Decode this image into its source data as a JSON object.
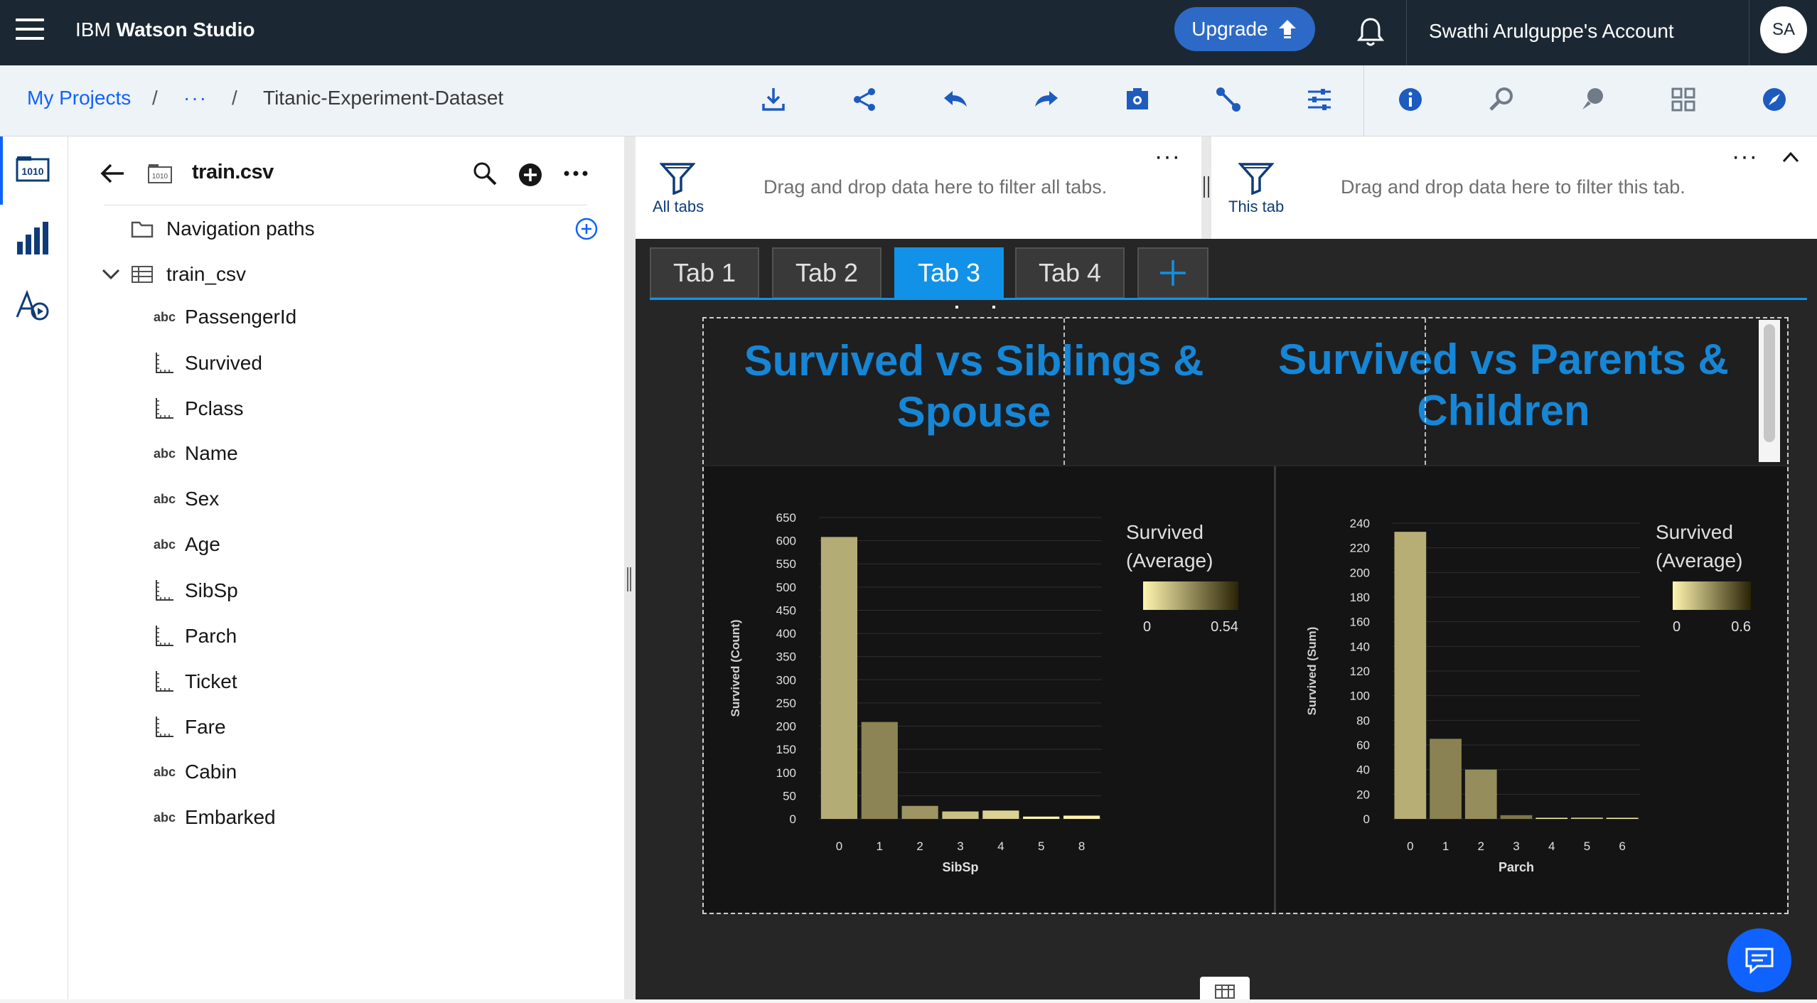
{
  "topbar": {
    "brand_prefix": "IBM",
    "brand_name": "Watson Studio",
    "upgrade_label": "Upgrade",
    "account_label": "Swathi Arulguppe's Account",
    "avatar_initials": "SA"
  },
  "breadcrumb": {
    "root": "My Projects",
    "sep1": "/",
    "ellipsis": "···",
    "sep2": "/",
    "current": "Titanic-Experiment-Dataset"
  },
  "toolbar_icons": [
    "download-icon",
    "share-icon",
    "undo-icon",
    "redo-icon",
    "screenshot-icon",
    "connect-icon",
    "settings-sliders-icon",
    "info-icon",
    "search-data-icon",
    "chat-assist-icon",
    "grid-icon",
    "compass-icon"
  ],
  "rail_icons": [
    "data-source-icon",
    "visualizations-icon",
    "assistant-icon"
  ],
  "panel": {
    "title": "train.csv",
    "nav_paths_label": "Navigation paths",
    "table_label": "train_csv",
    "columns": [
      {
        "label": "PassengerId",
        "type": "abc"
      },
      {
        "label": "Survived",
        "type": "measure"
      },
      {
        "label": "Pclass",
        "type": "measure"
      },
      {
        "label": "Name",
        "type": "abc"
      },
      {
        "label": "Sex",
        "type": "abc"
      },
      {
        "label": "Age",
        "type": "abc"
      },
      {
        "label": "SibSp",
        "type": "measure"
      },
      {
        "label": "Parch",
        "type": "measure"
      },
      {
        "label": "Ticket",
        "type": "measure"
      },
      {
        "label": "Fare",
        "type": "measure"
      },
      {
        "label": "Cabin",
        "type": "abc"
      },
      {
        "label": "Embarked",
        "type": "abc"
      }
    ],
    "abc_tag": "abc"
  },
  "filters": {
    "all_label": "All tabs",
    "all_text": "Drag and drop data here to filter all tabs.",
    "tab_label": "This tab",
    "tab_text": "Drag and drop data here to filter this tab.",
    "more": "···"
  },
  "tabs": [
    {
      "label": "Tab 1",
      "active": false
    },
    {
      "label": "Tab 2",
      "active": false
    },
    {
      "label": "Tab 3",
      "active": true
    },
    {
      "label": "Tab 4",
      "active": false
    }
  ],
  "titles": {
    "left": "Survived vs Siblings & Spouse",
    "right": "Survived vs Parents & Children"
  },
  "chart_data": [
    {
      "type": "bar",
      "categories": [
        "0",
        "1",
        "2",
        "3",
        "4",
        "5",
        "8"
      ],
      "values": [
        608,
        209,
        28,
        16,
        18,
        5,
        7
      ],
      "color_values": [
        0.35,
        0.54,
        0.46,
        0.25,
        0.17,
        0,
        0
      ],
      "xlabel": "SibSp",
      "ylabel": "Survived (Count)",
      "yticks": [
        0,
        50,
        100,
        150,
        200,
        250,
        300,
        350,
        400,
        450,
        500,
        550,
        600,
        650
      ],
      "ylim": [
        0,
        650
      ],
      "legend_title": "Survived (Average)",
      "legend_min": "0",
      "legend_max": "0.54",
      "grid": true
    },
    {
      "type": "bar",
      "categories": [
        "0",
        "1",
        "2",
        "3",
        "4",
        "5",
        "6"
      ],
      "values": [
        233,
        65,
        40,
        3,
        0,
        1,
        0
      ],
      "color_values": [
        0.34,
        0.55,
        0.5,
        0.6,
        0,
        0.2,
        0
      ],
      "xlabel": "Parch",
      "ylabel": "Survived (Sum)",
      "yticks": [
        0,
        20,
        40,
        60,
        80,
        100,
        120,
        140,
        160,
        180,
        200,
        220,
        240
      ],
      "ylim": [
        0,
        240
      ],
      "legend_title": "Survived (Average)",
      "legend_min": "0",
      "legend_max": "0.6",
      "grid": true
    }
  ],
  "colors": {
    "topbar": "#1b2834",
    "accent": "#1192e8",
    "title": "#1686d6",
    "grad_light": "#fff6b0",
    "grad_dark": "#2a2306"
  }
}
